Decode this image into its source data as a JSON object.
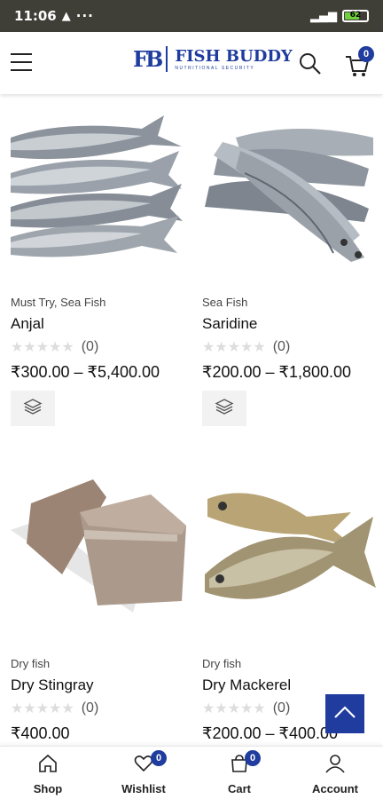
{
  "status_bar": {
    "time": "11:06",
    "battery": "62"
  },
  "header": {
    "brand": "FISH BUDDY",
    "tagline": "NUTRITIONAL SECURITY",
    "logo_mark": "FB",
    "cart_count": "0"
  },
  "products": [
    {
      "category": "Must Try, Sea Fish",
      "name": "Anjal",
      "rating_count": "(0)",
      "price": "₹300.00 – ₹5,400.00"
    },
    {
      "category": "Sea Fish",
      "name": "Saridine",
      "rating_count": "(0)",
      "price": "₹200.00 – ₹1,800.00"
    },
    {
      "category": "Dry fish",
      "name": "Dry Stingray",
      "rating_count": "(0)",
      "price": "₹400.00"
    },
    {
      "category": "Dry fish",
      "name": "Dry Mackerel",
      "rating_count": "(0)",
      "price": "₹200.00 – ₹400.00"
    }
  ],
  "bottom_nav": {
    "shop": "Shop",
    "wishlist": "Wishlist",
    "wishlist_count": "0",
    "cart": "Cart",
    "cart_count": "0",
    "account": "Account"
  },
  "colors": {
    "accent": "#1f3c9e",
    "status_bar": "#3f3f38"
  }
}
